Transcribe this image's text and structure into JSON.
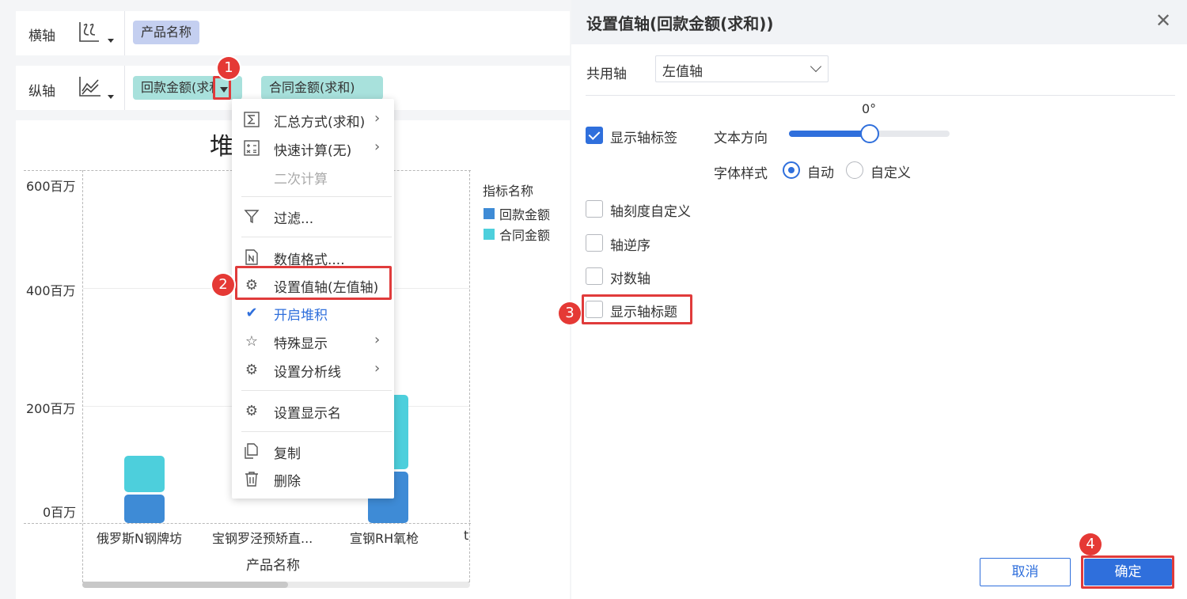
{
  "axes": {
    "x_label": "横轴",
    "x_field": "产品名称",
    "y_label": "纵轴",
    "y_fields": [
      "回款金额(求和)",
      "合同金额(求和)"
    ],
    "x_icon": "bar-chart-icon",
    "y_icon": "line-chart-icon"
  },
  "chart": {
    "title_partial": "堆",
    "legend_title": "指标名称",
    "legend": [
      {
        "name": "回款金额",
        "color": "#3e8bd6"
      },
      {
        "name": "合同金额",
        "color": "#4dcfdc"
      }
    ],
    "xlabel": "产品名称"
  },
  "chart_data": {
    "type": "bar",
    "stacked": true,
    "categories": [
      "俄罗斯N钢牌坊",
      "宝钢罗泾预矫直...",
      "宣钢RH氧枪",
      "t"
    ],
    "series": [
      {
        "name": "回款金额",
        "values": [
          48,
          null,
          88,
          null
        ]
      },
      {
        "name": "合同金额",
        "values": [
          67,
          null,
          130,
          null
        ]
      }
    ],
    "ytick_labels": [
      "0百万",
      "200百万",
      "400百万",
      "600百万"
    ],
    "ylim": [
      0,
      600
    ],
    "xlabel": "产品名称",
    "legend_title": "指标名称",
    "legend": "right"
  },
  "menu": {
    "items": [
      {
        "icon": "sum-icon",
        "label": "汇总方式(求和)",
        "arrow": true,
        "disabled": false
      },
      {
        "icon": "calculator-icon",
        "label": "快速计算(无)",
        "arrow": true,
        "disabled": false
      },
      {
        "icon": "",
        "label": "二次计算",
        "arrow": false,
        "disabled": true
      },
      {
        "icon": "filter-icon",
        "label": "过滤...",
        "arrow": false,
        "disabled": false
      },
      {
        "icon": "number-format-icon",
        "label": "数值格式....",
        "arrow": false,
        "disabled": false
      },
      {
        "icon": "gear-icon",
        "label": "设置值轴(左值轴)",
        "arrow": false,
        "disabled": false
      },
      {
        "icon": "check-icon",
        "label": "开启堆积",
        "arrow": false,
        "disabled": false,
        "active": true
      },
      {
        "icon": "star-icon",
        "label": "特殊显示",
        "arrow": true,
        "disabled": false
      },
      {
        "icon": "gear-icon",
        "label": "设置分析线",
        "arrow": true,
        "disabled": false
      },
      {
        "icon": "gear-icon",
        "label": "设置显示名",
        "arrow": false,
        "disabled": false
      },
      {
        "icon": "copy-icon",
        "label": "复制",
        "arrow": false,
        "disabled": false
      },
      {
        "icon": "trash-icon",
        "label": "删除",
        "arrow": false,
        "disabled": false
      }
    ]
  },
  "badges": [
    "1",
    "2",
    "3",
    "4"
  ],
  "dialog": {
    "title": "设置值轴(回款金额(求和))",
    "shared_axis_label": "共用轴",
    "shared_axis_value": "左值轴",
    "show_axis_labels": {
      "label": "显示轴标签",
      "checked": true
    },
    "text_direction_label": "文本方向",
    "text_direction_value": "0°",
    "text_direction_fraction": 0.5,
    "font_style_label": "字体样式",
    "font_style_options": [
      "自动",
      "自定义"
    ],
    "font_style_selected": "自动",
    "custom_scale": {
      "label": "轴刻度自定义",
      "checked": false
    },
    "reverse_axis": {
      "label": "轴逆序",
      "checked": false
    },
    "log_axis": {
      "label": "对数轴",
      "checked": false
    },
    "show_axis_title": {
      "label": "显示轴标题",
      "checked": false
    },
    "cancel_label": "取消",
    "ok_label": "确定",
    "accent_color": "#2f6fdc",
    "highlight_color": "#e03b3b"
  }
}
